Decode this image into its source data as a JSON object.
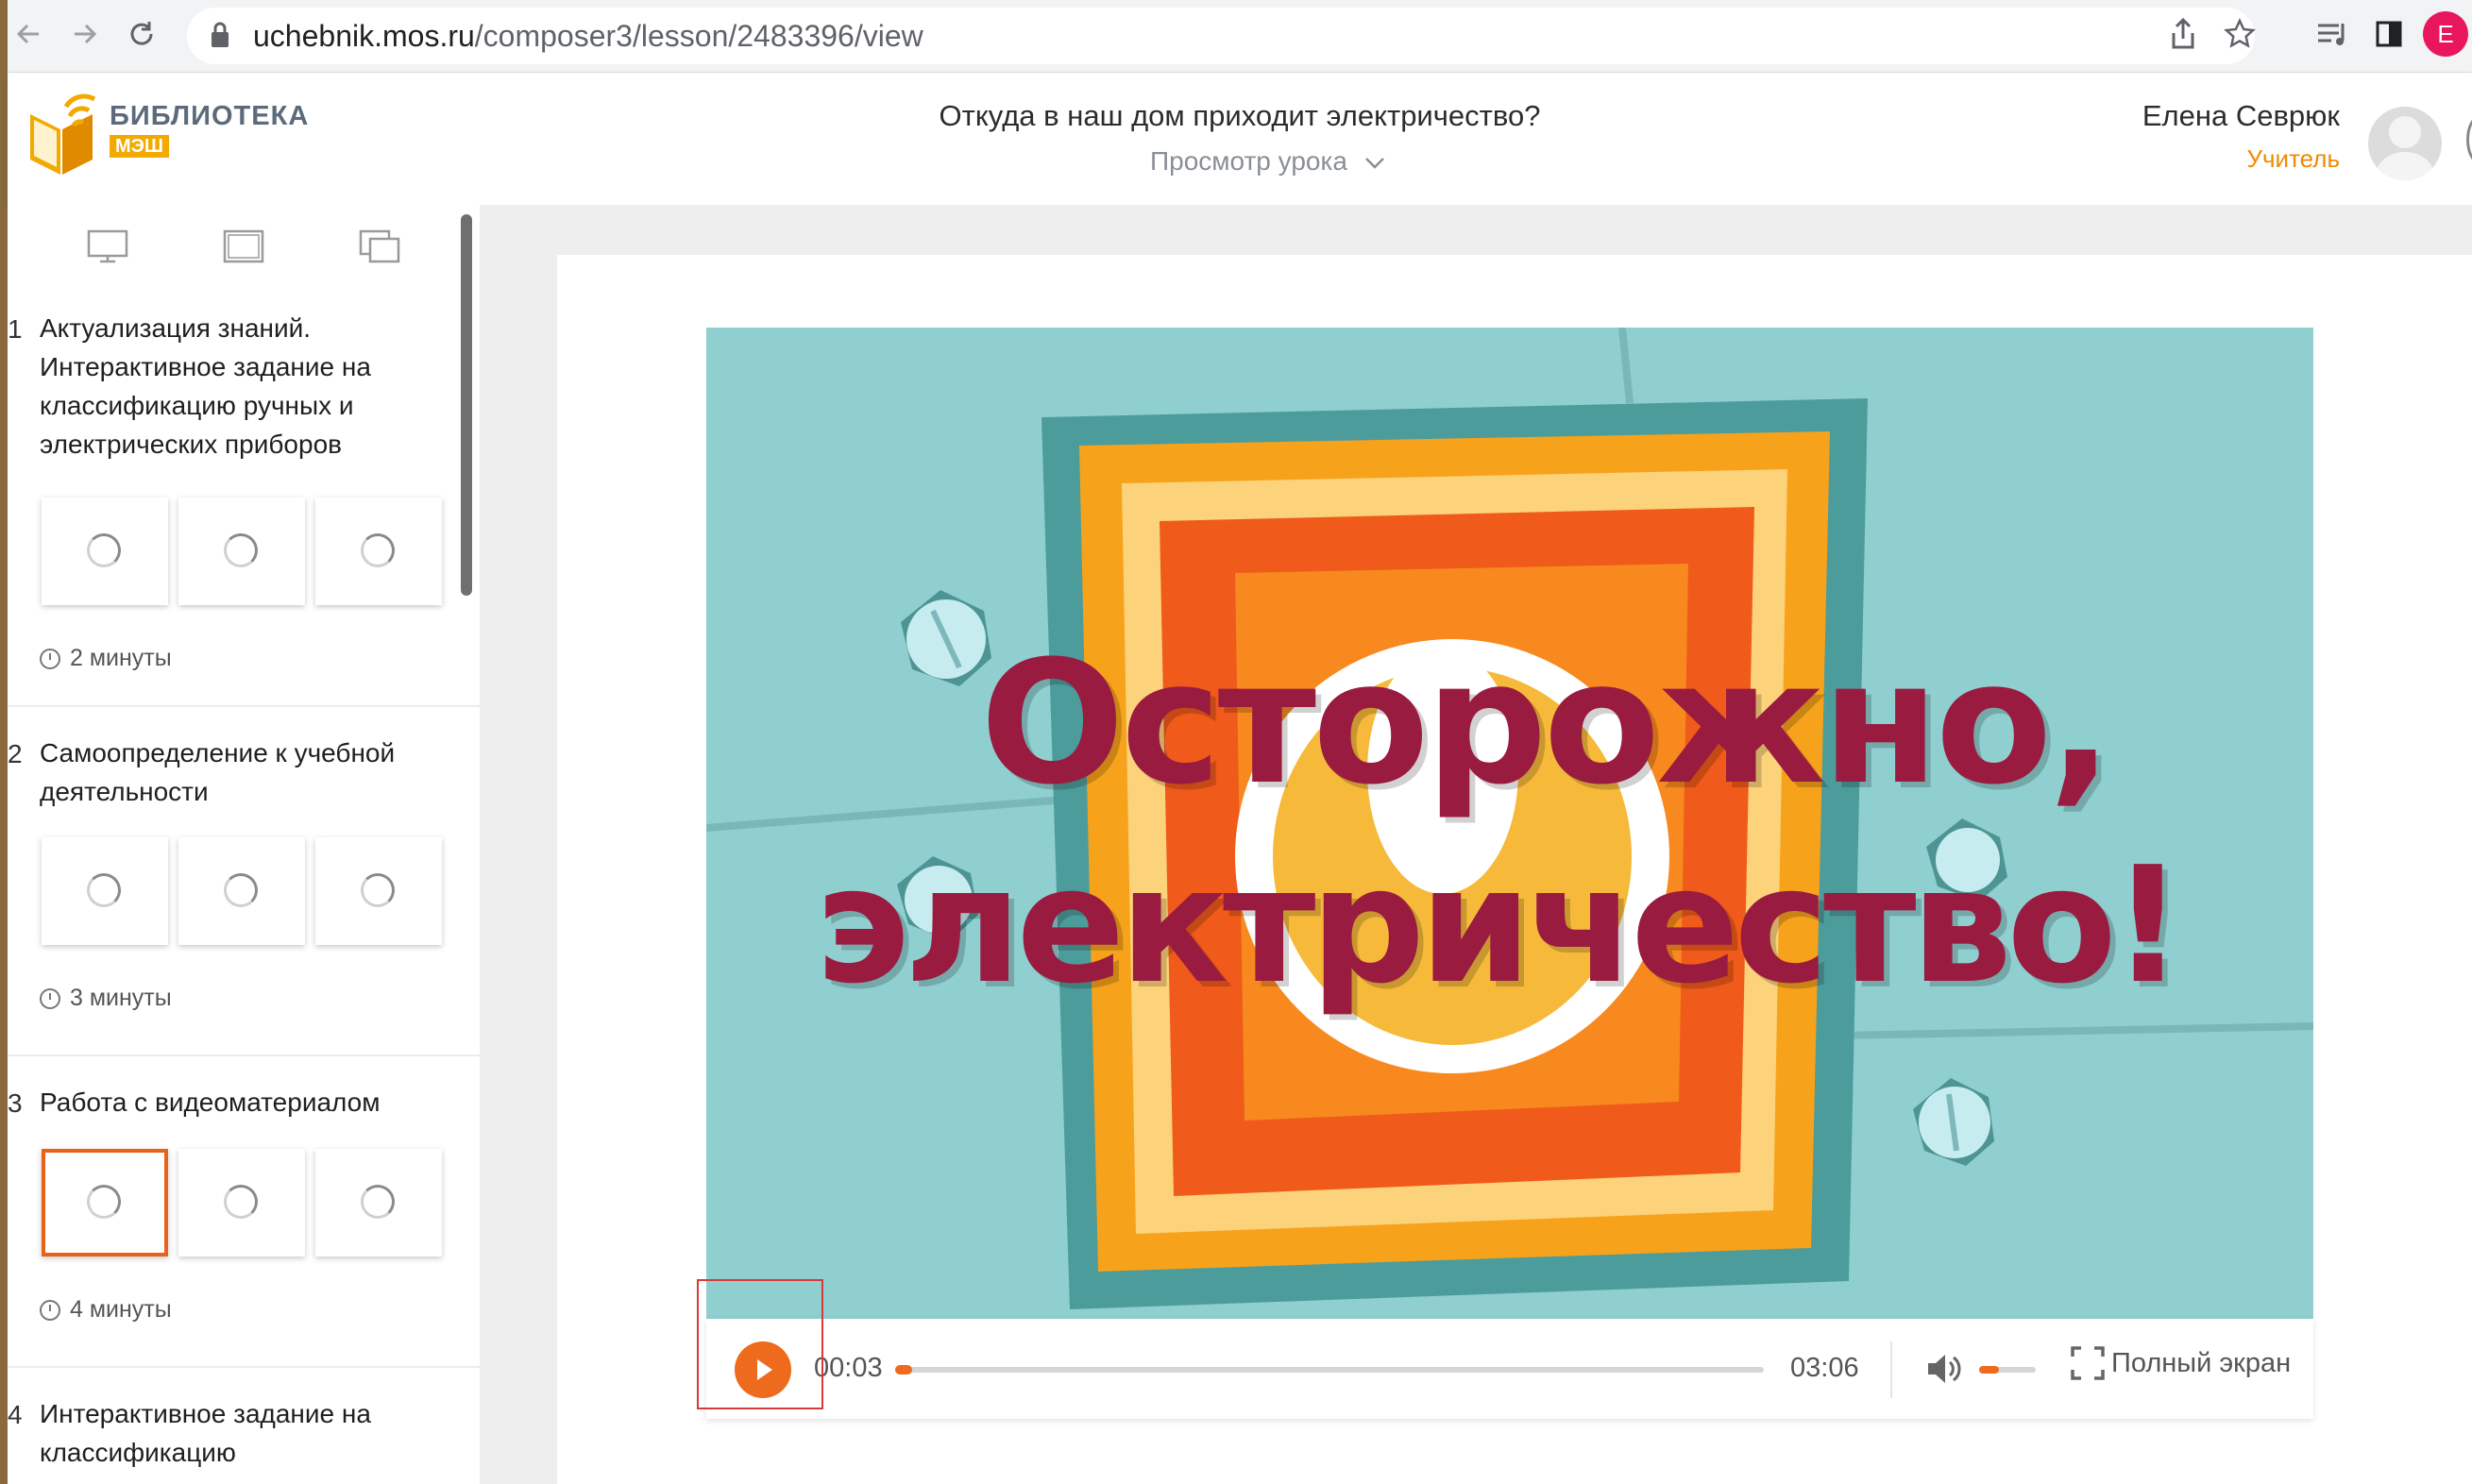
{
  "browser": {
    "url_host": "uchebnik.mos.ru",
    "url_path": "/composer3/lesson/2483396/view",
    "back_icon": "arrow-left-icon",
    "forward_icon": "arrow-right-icon",
    "reload_icon": "reload-icon",
    "profile_initial": "E",
    "profile_color": "#e8175d"
  },
  "header": {
    "logo_title": "БИБЛИОТЕКА",
    "logo_sub": "МЭШ",
    "lesson_title": "Откуда в наш дом приходит электричество?",
    "lesson_mode": "Просмотр урока",
    "user_name": "Елена Севрюк",
    "user_role": "Учитель"
  },
  "sidebar": {
    "sections": [
      {
        "number": "1",
        "title": "Актуализация знаний. Интерактивное задание на классификацию ручных и электрических приборов",
        "duration": "2 минуты"
      },
      {
        "number": "2",
        "title": "Самоопределение к учебной деятельности",
        "duration": "3 минуты"
      },
      {
        "number": "3",
        "title": "Работа с видеоматериалом",
        "duration": "4 минуты"
      },
      {
        "number": "4",
        "title": "Интерактивное задание на классификацию"
      }
    ]
  },
  "video": {
    "title_line1": "Осторожно,",
    "title_line2": "электричество!",
    "current_time": "00:03",
    "total_time": "03:06",
    "progress": 0.016,
    "volume": 0.35,
    "fullscreen_label": "Полный экран",
    "accent_color": "#ee6a1c"
  }
}
